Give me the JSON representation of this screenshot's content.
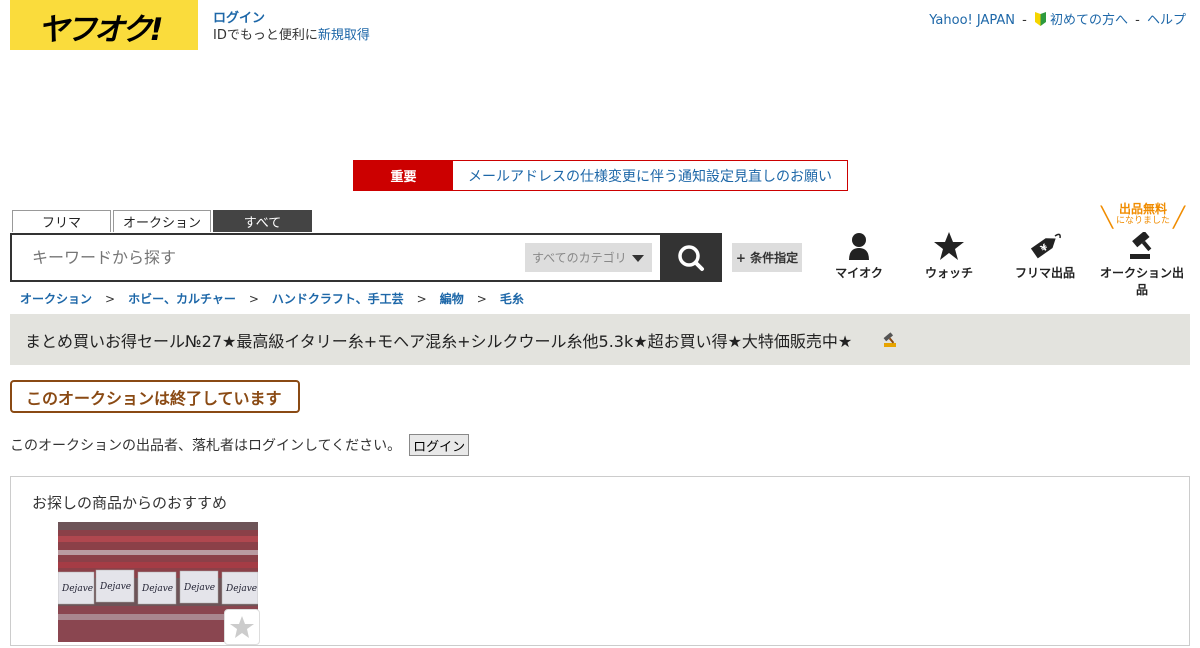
{
  "header": {
    "logo_text": "ヤフオク!",
    "login_label": "ログイン",
    "login_sub_prefix": "IDでもっと便利に",
    "register_label": "新規取得",
    "top_links": [
      "Yahoo! JAPAN",
      "初めての方へ",
      "ヘルプ"
    ],
    "separator": "-"
  },
  "notice": {
    "label": "重要",
    "text": "メールアドレスの仕様変更に伴う通知設定見直しのお願い"
  },
  "tabs": [
    {
      "label": "フリマ",
      "active": false
    },
    {
      "label": "オークション",
      "active": false
    },
    {
      "label": "すべて",
      "active": true
    }
  ],
  "search": {
    "placeholder": "キーワードから探す",
    "category": "すべてのカテゴリ",
    "condition_label": "+ 条件指定"
  },
  "quick_nav": [
    {
      "label": "マイオク",
      "icon": "user-icon"
    },
    {
      "label": "ウォッチ",
      "icon": "star-icon"
    },
    {
      "label": "フリマ出品",
      "icon": "price-tag-icon"
    },
    {
      "label": "オークション出品",
      "icon": "gavel-icon"
    }
  ],
  "free_badge": {
    "line1": "出品無料",
    "line2": "になりました"
  },
  "breadcrumb": [
    "オークション",
    "ホビー、カルチャー",
    "ハンドクラフト、手工芸",
    "編物",
    "毛糸"
  ],
  "breadcrumb_separator": ">",
  "item": {
    "title": "まとめ買いお得セール№27★最高級イタリー糸+モヘア混糸+シルクウール糸他5.3k★超お買い得★大特価販売中★"
  },
  "ended_message": "このオークションは終了しています",
  "login_note": "このオークションの出品者、落札者はログインしてください。",
  "login_button": "ログイン",
  "recommendation": {
    "title": "お探しの商品からのおすすめ",
    "yarn_labels": [
      "Dejave",
      "Dejave",
      "Dejave",
      "Dejave",
      "Dejave"
    ]
  },
  "colors": {
    "logo_yellow": "#fadc3c",
    "notice_red": "#cc0000",
    "link_blue": "#1d67a8",
    "ended_brown": "#8a4a14",
    "badge_orange": "#f08c00"
  }
}
